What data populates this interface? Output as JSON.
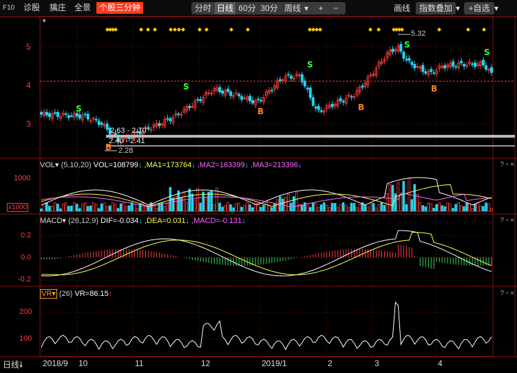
{
  "toolbar": {
    "f10": "F10",
    "items": [
      "诊股",
      "擒庄",
      "全景"
    ],
    "active_tab": "个股三分钟",
    "periods": [
      "分时",
      "日线",
      "60分",
      "30分",
      "周线"
    ],
    "selected_period": "日线",
    "zoom_in": "+",
    "zoom_out": "−",
    "draw": "画线",
    "index_overlay": "指数叠加",
    "add_watch": "+自选",
    "dropdown_glyph": "▾"
  },
  "colors": {
    "up": "#ff3b3b",
    "down": "#22d3ee",
    "accent": "#ff3b1f",
    "border": "#8a1111"
  },
  "price_panel": {
    "y_ticks": [
      "5",
      "4",
      "3"
    ],
    "high_label": "5.32",
    "low_label": "2.28",
    "range_box_1": "2.63 - 2.70",
    "range_box_2": "2.40 - 2.41",
    "buy_mark": "B",
    "sell_mark": "S"
  },
  "vol_panel": {
    "name": "VOL",
    "params": "(5,10,20)",
    "vol": "VOL=108799",
    "ma1": ",MA1=173764",
    "ma2": ",MA2=163399",
    "ma3": ",MA3=213396",
    "y_tick": "1000",
    "unit": "x1000"
  },
  "macd_panel": {
    "name": "MACD",
    "params": "(26,12,9)",
    "dif": "DIF=-0.034",
    "dea": ",DEA=0.031",
    "macd": ",MACD=-0.131",
    "y_ticks": [
      "0.2",
      "0.0",
      "-0.2"
    ]
  },
  "vr_panel": {
    "name": "VR",
    "params": "(26)",
    "value": "VR=86.15",
    "y_ticks": [
      "200",
      "100"
    ]
  },
  "panel_controls": "? ▫ ×",
  "bottom_axis": {
    "period_label": "日线",
    "dates": [
      "2018/9",
      "10",
      "11",
      "12",
      "2019/1",
      "2",
      "3",
      "4"
    ]
  },
  "chart_data": {
    "type": "candlestick",
    "x_range": [
      "2018/9",
      "2019/4"
    ],
    "price_ylim": [
      2.2,
      5.5
    ],
    "price_high": 5.32,
    "price_low": 2.28,
    "macd_ylim": [
      -0.25,
      0.3
    ],
    "vr_ylim": [
      40,
      230
    ]
  }
}
